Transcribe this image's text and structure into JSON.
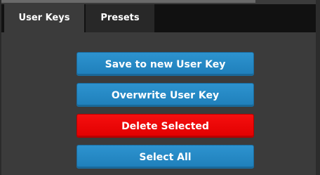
{
  "tabs": [
    {
      "label": "User Keys",
      "active": true
    },
    {
      "label": "Presets",
      "active": false
    }
  ],
  "buttons": {
    "save_new": "Save to new User Key",
    "overwrite": "Overwrite User Key",
    "delete_selected": "Delete Selected",
    "select_all": "Select All"
  },
  "colors": {
    "button_blue": "#2589c6",
    "button_red": "#ee0808",
    "tab_strip": "#111111",
    "panel_bg": "#3b3b3b"
  }
}
